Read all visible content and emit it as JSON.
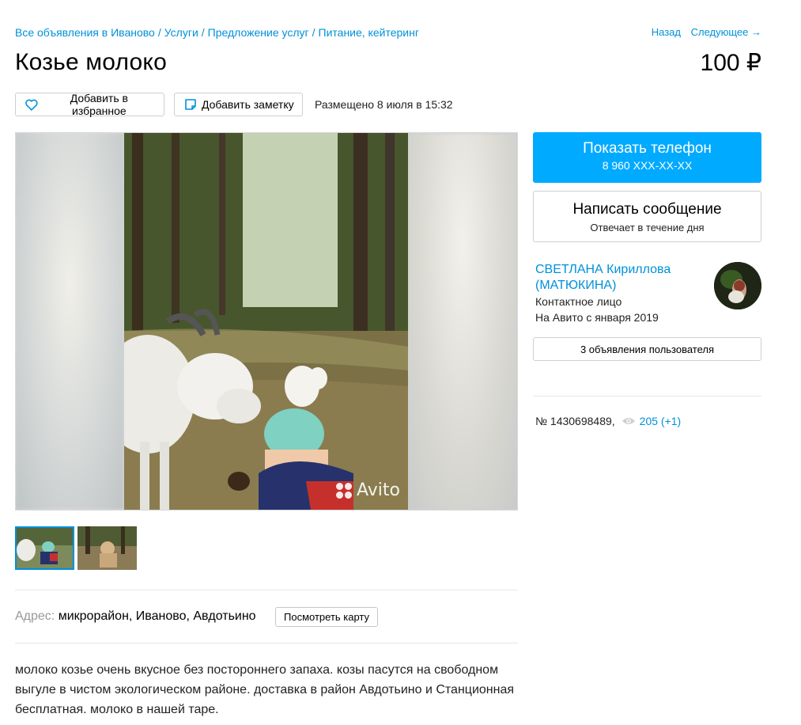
{
  "breadcrumb": {
    "items": [
      "Все объявления в Иваново",
      "Услуги",
      "Предложение услуг",
      "Питание, кейтеринг"
    ]
  },
  "nav": {
    "back": "Назад",
    "next": "Следующее →"
  },
  "listing": {
    "title": "Козье молоко",
    "price": "100 ₽",
    "posted": "Размещено 8 июля в 15:32",
    "number": "№ 1430698489,",
    "views": "205 (+1)"
  },
  "actions": {
    "favorite": "Добавить в избранное",
    "note": "Добавить заметку",
    "show_phone": "Показать телефон",
    "phone_masked": "8 960 XXX-XX-XX",
    "write_message": "Написать сообщение",
    "reply_time": "Отвечает в течение дня",
    "user_ads": "3 объявления пользователя",
    "view_map": "Посмотреть карту"
  },
  "seller": {
    "name": "СВЕТЛАНА Кириллова (МАТЮКИНА)",
    "role": "Контактное лицо",
    "since": "На Авито с января 2019"
  },
  "address": {
    "label": "Адрес:",
    "value": "микрорайон, Иваново, Авдотьино"
  },
  "description": "молоко козье очень вкусное без постороннего запаха. козы пасутся на свободном выгуле в чистом экологическом районе. доставка в район Авдотьино и Станционная бесплатная. молоко в нашей таре.",
  "gallery": {
    "watermark": "Avito"
  },
  "colors": {
    "accent": "#00aaff",
    "link": "#0091d9",
    "border": "#cfcfcf"
  },
  "icons": [
    "heart-icon",
    "note-icon",
    "eye-icon"
  ]
}
